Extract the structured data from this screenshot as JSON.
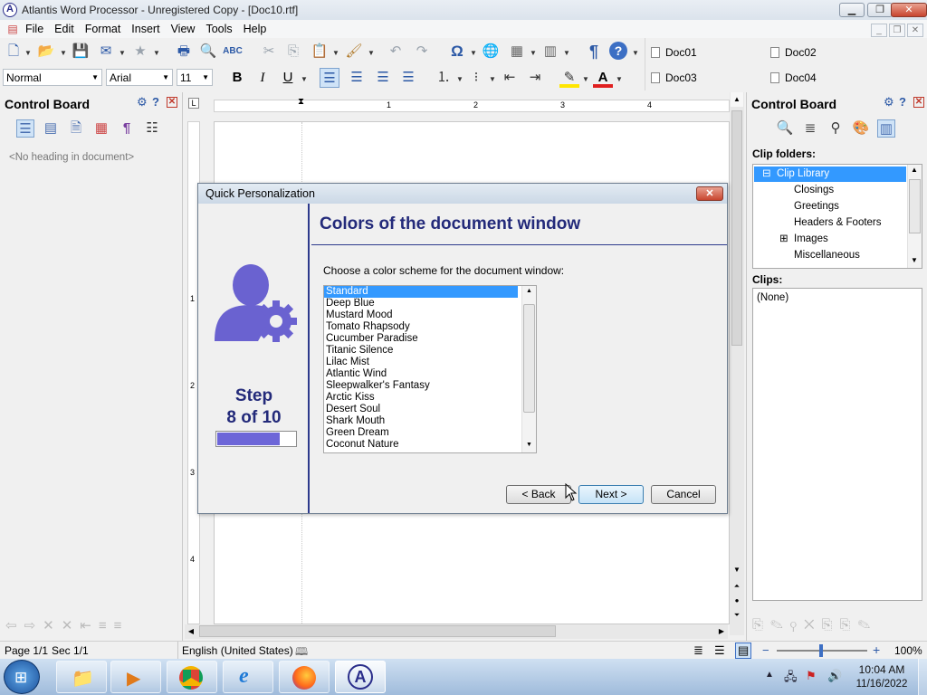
{
  "window": {
    "title": "Atlantis Word Processor - Unregistered Copy - [Doc10.rtf]",
    "logo_letter": "A",
    "controls": {
      "minimize": "▁",
      "restore": "❐",
      "close": "✕"
    }
  },
  "menu": [
    "File",
    "Edit",
    "Format",
    "Insert",
    "View",
    "Tools",
    "Help"
  ],
  "mdi_controls": {
    "minimize": "_",
    "restore": "❐",
    "close": "✕"
  },
  "toolbar": {
    "style_value": "Normal",
    "font_value": "Arial",
    "size_value": "11",
    "bold": "B",
    "italic": "I",
    "underline": "U",
    "pilcrow": "¶",
    "omega": "Ω",
    "help": "?"
  },
  "documents": [
    "Doc01",
    "Doc02",
    "Doc03",
    "Doc04"
  ],
  "left_panel": {
    "title": "Control Board",
    "empty_text": "<No heading in document>"
  },
  "ruler": {
    "h_numbers": [
      "1",
      "2",
      "3",
      "4"
    ],
    "v_numbers": [
      "1",
      "2",
      "3",
      "4"
    ]
  },
  "dialog": {
    "title": "Quick Personalization",
    "close": "✕",
    "heading": "Colors of the document window",
    "prompt": "Choose a color scheme for the document window:",
    "step_label": "Step",
    "step_count": "8 of 10",
    "progress": 0.8,
    "schemes": [
      "Standard",
      "Deep Blue",
      "Mustard Mood",
      "Tomato Rhapsody",
      "Cucumber Paradise",
      "Titanic Silence",
      "Lilac Mist",
      "Atlantic Wind",
      "Sleepwalker's Fantasy",
      "Arctic Kiss",
      "Desert Soul",
      "Shark Mouth",
      "Green Dream",
      "Coconut Nature"
    ],
    "selected_scheme": "Standard",
    "buttons": {
      "back": "< Back",
      "next": "Next >",
      "cancel": "Cancel"
    }
  },
  "right_panel": {
    "title": "Control Board",
    "clip_folders_label": "Clip folders:",
    "folders": [
      "Clip Library",
      "Closings",
      "Greetings",
      "Headers & Footers",
      "Images",
      "Miscellaneous"
    ],
    "selected_folder": "Clip Library",
    "clips_label": "Clips:",
    "clips_empty": "(None)"
  },
  "status": {
    "page": "Page 1/1",
    "section": "Sec 1/1",
    "language": "English (United States)",
    "zoom": "100%"
  },
  "taskbar": {
    "time": "10:04 AM",
    "date": "11/16/2022",
    "active_app_letter": "A"
  },
  "colors": {
    "accent": "#232a7a",
    "selection": "#3399ff",
    "progress": "#6d66d8",
    "brand_icon": "#6a62d0"
  }
}
